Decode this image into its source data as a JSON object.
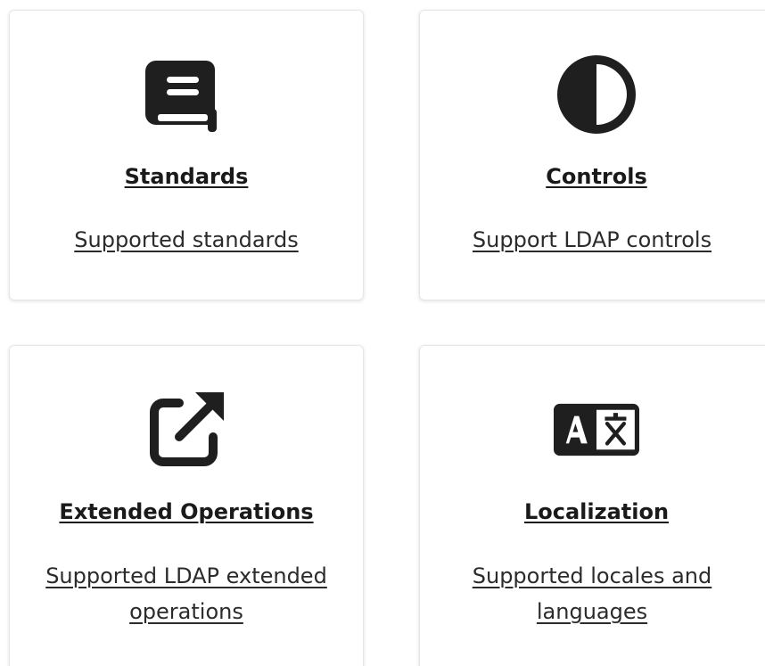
{
  "cards": [
    {
      "icon": "book-icon",
      "title": "Standards",
      "description": "Supported standards"
    },
    {
      "icon": "contrast-icon",
      "title": "Controls",
      "description": "Support LDAP controls"
    },
    {
      "icon": "external-link-icon",
      "title": "Extended Operations",
      "description": "Supported LDAP extended operations"
    },
    {
      "icon": "translate-icon",
      "title": "Localization",
      "description": "Supported locales and languages"
    }
  ],
  "colors": {
    "icon": "#1f1f1f",
    "text": "#1a1a1a",
    "card_border": "#e6e6e6"
  }
}
